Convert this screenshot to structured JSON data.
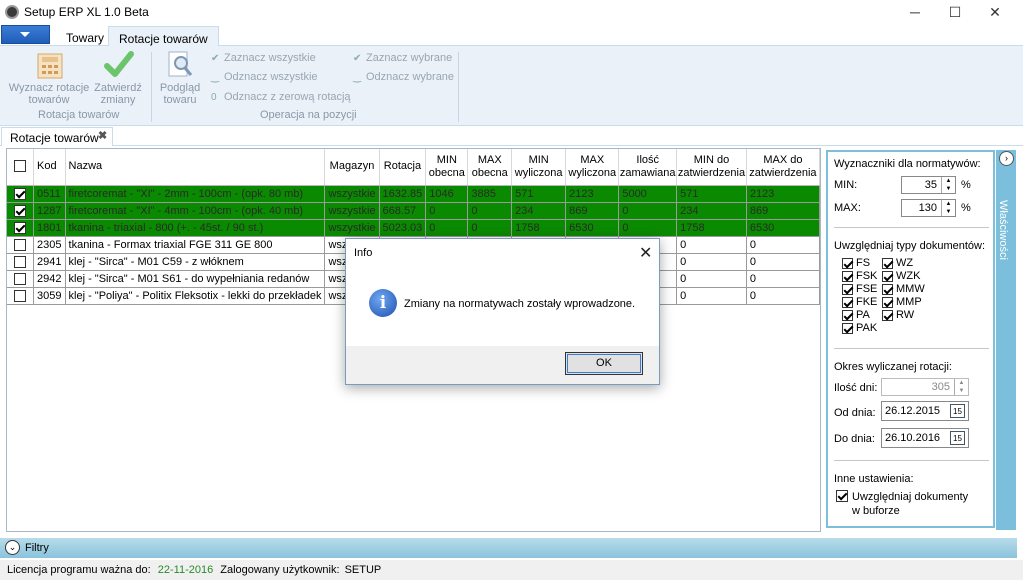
{
  "window": {
    "title": "Setup ERP XL 1.0 Beta",
    "min": "─",
    "max": "☐",
    "close": "✕"
  },
  "ribbon_tabs": [
    "Towary",
    "Rotacje towarów"
  ],
  "ribbon": {
    "btn1": [
      "Wyznacz rotacje",
      "towarów"
    ],
    "btn2": [
      "Zatwierdź",
      "zmiany"
    ],
    "group1": "Rotacja towarów",
    "btn3": [
      "Podgląd",
      "towaru"
    ],
    "op_select_all": "Zaznacz wszystkie",
    "op_deselect_all": "Odznacz wszystkie",
    "op_deselect_zero": "Odznacz z zerową rotacją",
    "op_select_chosen": "Zaznacz wybrane",
    "op_deselect_chosen": "Odznacz wybrane",
    "group2": "Operacja na pozycji"
  },
  "doc_tab": {
    "label": "Rotacje towarów",
    "close": "✖"
  },
  "grid": {
    "headers": [
      "Kod",
      "Nazwa",
      "Magazyn",
      "Rotacja",
      "MIN obecna",
      "MAX obecna",
      "MIN wyliczona",
      "MAX wyliczona",
      "Ilość zamawiana",
      "MIN do zatwierdzenia",
      "MAX do zatwierdzenia"
    ],
    "rows": [
      {
        "checked": true,
        "sel": true,
        "cells": [
          "0511",
          "firetcoremat - \"XI\" - 2mm - 100cm - (opk. 80 mb)",
          "wszystkie",
          "1632.85",
          "1046",
          "3885",
          "571",
          "2123",
          "5000",
          "571",
          "2123"
        ]
      },
      {
        "checked": true,
        "sel": true,
        "cells": [
          "1287",
          "firetcoremat - \"XI\" - 4mm - 100cm - (opk. 40 mb)",
          "wszystkie",
          "668.57",
          "0",
          "0",
          "234",
          "869",
          "0",
          "234",
          "869"
        ]
      },
      {
        "checked": true,
        "sel": true,
        "cells": [
          "1801",
          "tkanina - triaxial - 800 (+. - 45st. / 90 st.)",
          "wszystkie",
          "5023.03",
          "0",
          "0",
          "1758",
          "6530",
          "0",
          "1758",
          "6530"
        ]
      },
      {
        "checked": false,
        "sel": false,
        "cells": [
          "2305",
          "tkanina - Formax triaxial FGE 311 GE 800",
          "wszy",
          "",
          "",
          "",
          "",
          "",
          "",
          "0",
          "0"
        ]
      },
      {
        "checked": false,
        "sel": false,
        "cells": [
          "2941",
          "klej - \"Sirca\" - M01 C59  - z włóknem",
          "wszy",
          "",
          "",
          "",
          "",
          "",
          "",
          "0",
          "0"
        ]
      },
      {
        "checked": false,
        "sel": false,
        "cells": [
          "2942",
          "klej - \"Sirca\" - M01 S61  - do wypełniania redanów",
          "wszy",
          "",
          "",
          "",
          "",
          "",
          "",
          "0",
          "0"
        ]
      },
      {
        "checked": false,
        "sel": false,
        "cells": [
          "3059",
          "klej - \"Poliya\" - Politix Fleksotix  - lekki do przekładek",
          "wszy",
          "",
          "",
          "",
          "",
          "",
          "",
          "0",
          "0"
        ]
      }
    ]
  },
  "props": {
    "strip_label": "Właściwości",
    "norm_title": "Wyznaczniki dla normatywów:",
    "min_label": "MIN:",
    "min_value": "35",
    "max_label": "MAX:",
    "max_value": "130",
    "pct": "%",
    "doc_types_title": "Uwzględniaj typy dokumentów:",
    "doc_types_left": [
      "FS",
      "FSK",
      "FSE",
      "FKE",
      "PA",
      "PAK"
    ],
    "doc_types_right": [
      "WZ",
      "WZK",
      "MMW",
      "MMP",
      "RW"
    ],
    "period_title": "Okres wyliczanej rotacji:",
    "days_label": "Ilość dni:",
    "days_value": "305",
    "from_label": "Od dnia:",
    "from_value": "26.12.2015",
    "to_label": "Do dnia:",
    "to_value": "26.10.2016",
    "cal": "15",
    "other_title": "Inne ustawienia:",
    "buffer_label1": "Uwzględniaj dokumenty",
    "buffer_label2": "w buforze"
  },
  "filters": {
    "label": "Filtry"
  },
  "status": {
    "license_label": "Licencja programu ważna do:",
    "license_date": "22-11-2016",
    "user_label": "Zalogowany użytkownik:",
    "user": "SETUP"
  },
  "dialog": {
    "title": "Info",
    "message": "Zmiany na normatywach zostały wprowadzone.",
    "ok": "OK",
    "close": "✕",
    "icon": "i"
  }
}
